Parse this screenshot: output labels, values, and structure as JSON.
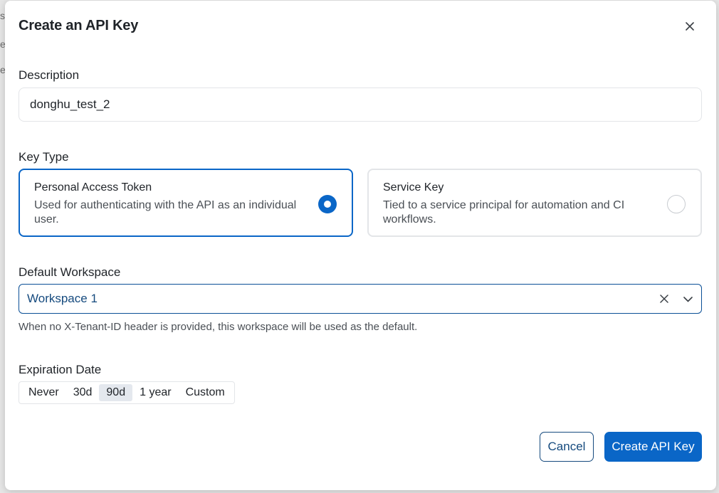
{
  "background": {
    "fragments": [
      "s",
      "e",
      "e"
    ]
  },
  "modal": {
    "title": "Create an API Key",
    "close_icon": "close-icon"
  },
  "description": {
    "label": "Description",
    "value": "donghu_test_2"
  },
  "key_type": {
    "label": "Key Type",
    "options": [
      {
        "title": "Personal Access Token",
        "description": "Used for authenticating with the API as an individual user.",
        "selected": true
      },
      {
        "title": "Service Key",
        "description": "Tied to a service principal for automation and CI workflows.",
        "selected": false
      }
    ]
  },
  "workspace": {
    "label": "Default Workspace",
    "selected": "Workspace 1",
    "helper": "When no X-Tenant-ID header is provided, this workspace will be used as the default."
  },
  "expiration": {
    "label": "Expiration Date",
    "options": [
      "Never",
      "30d",
      "90d",
      "1 year",
      "Custom"
    ],
    "selected": "90d"
  },
  "actions": {
    "cancel_label": "Cancel",
    "create_label": "Create API Key"
  },
  "colors": {
    "primary": "#0a66c7",
    "primary_dark": "#154a7e",
    "border": "#e3e5e8",
    "segment_active": "#e4e8ee"
  }
}
